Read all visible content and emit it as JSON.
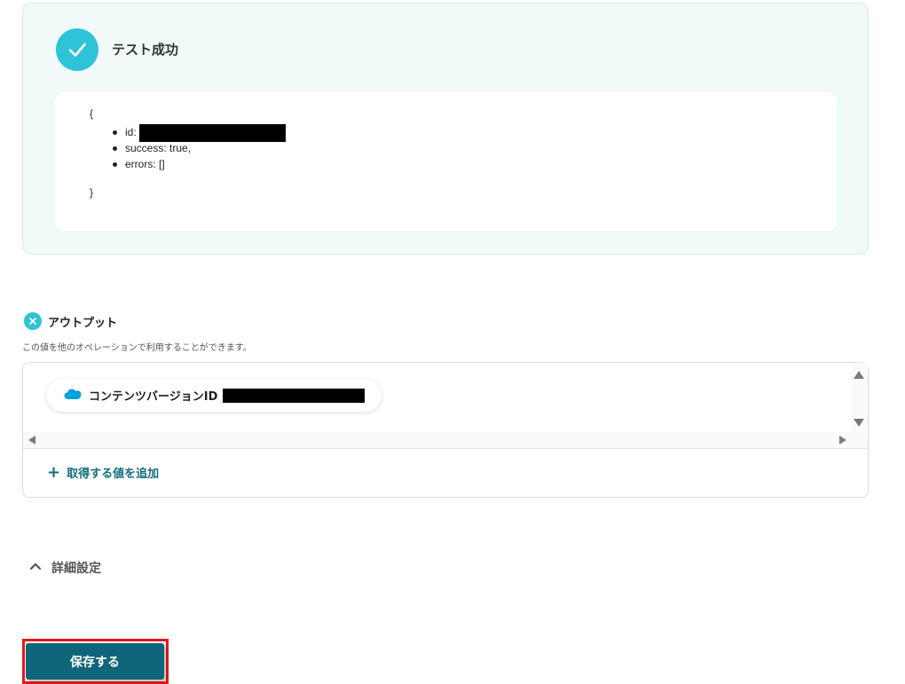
{
  "test_result": {
    "title": "テスト成功",
    "json_open": "{",
    "json_close": "}",
    "fields": [
      {
        "text": "id: ",
        "redacted": true
      },
      {
        "text": "success: true,",
        "redacted": false
      },
      {
        "text": "errors: []",
        "redacted": false
      }
    ]
  },
  "output": {
    "title": "アウトプット",
    "description": "この値を他のオペレーションで利用することができます。",
    "chips": [
      {
        "label": "コンテンツバージョンID",
        "icon": "salesforce-cloud-icon"
      }
    ],
    "add_label": "取得する値を追加"
  },
  "advanced": {
    "label": "詳細設定"
  },
  "actions": {
    "save_label": "保存する"
  },
  "colors": {
    "accent": "#2ec3d6",
    "primary": "#0f6579",
    "link": "#146e7e",
    "highlight": "#e01b1b",
    "salesforce": "#00a1e0"
  }
}
